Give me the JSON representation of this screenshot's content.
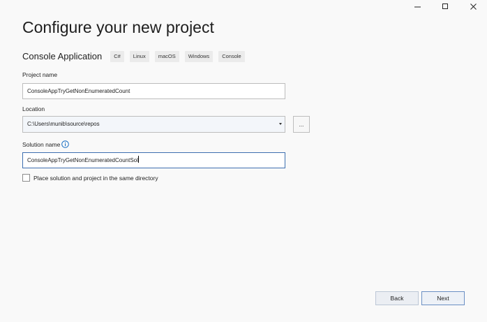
{
  "window": {
    "controls": [
      {
        "name": "minimize-icon"
      },
      {
        "name": "maximize-icon"
      },
      {
        "name": "close-icon"
      }
    ]
  },
  "page": {
    "title": "Configure your new project"
  },
  "template": {
    "name": "Console Application",
    "tags": [
      "C#",
      "Linux",
      "macOS",
      "Windows",
      "Console"
    ]
  },
  "form": {
    "project_name": {
      "label": "Project name",
      "value": "ConsoleAppTryGetNonEnumeratedCount"
    },
    "location": {
      "label": "Location",
      "value": "C:\\Users\\munib\\source\\repos",
      "browse_label": "..."
    },
    "solution_name": {
      "label": "Solution name",
      "value": "ConsoleAppTryGetNonEnumeratedCountSol",
      "info_icon": "info-icon"
    },
    "same_directory": {
      "label": "Place solution and project in the same directory",
      "checked": false
    }
  },
  "footer": {
    "back_label": "Back",
    "next_label": "Next"
  },
  "colors": {
    "background": "#f9f9f9",
    "accent": "#3d6fb0",
    "info": "#1a6fc4"
  }
}
